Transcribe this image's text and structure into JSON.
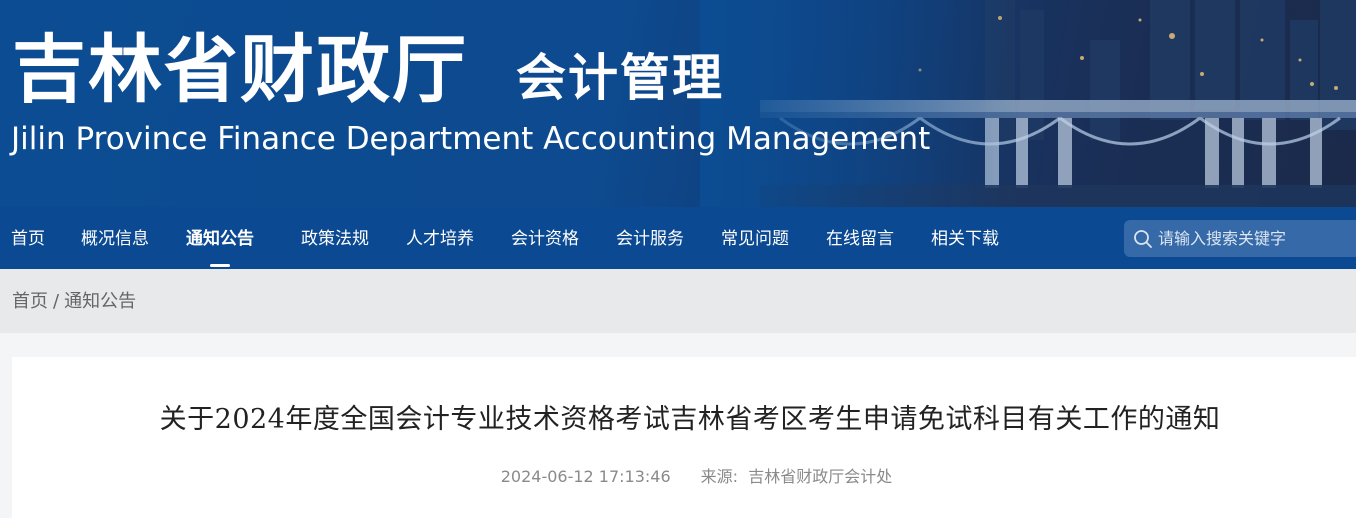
{
  "header": {
    "title": "吉林省财政厅",
    "subtitle": "会计管理",
    "english_title": "Jilin Province Finance Department Accounting Management"
  },
  "nav": {
    "items": [
      {
        "label": "首页"
      },
      {
        "label": "概况信息"
      },
      {
        "label": "通知公告"
      },
      {
        "label": "政策法规"
      },
      {
        "label": "人才培养"
      },
      {
        "label": "会计资格"
      },
      {
        "label": "会计服务"
      },
      {
        "label": "常见问题"
      },
      {
        "label": "在线留言"
      },
      {
        "label": "相关下载"
      }
    ],
    "active": "通知公告"
  },
  "search": {
    "placeholder": "请输入搜索关键字",
    "icon": "search-icon"
  },
  "breadcrumb": {
    "home": "首页",
    "separator": "/",
    "current": "通知公告"
  },
  "article": {
    "title": "关于2024年度全国会计专业技术资格考试吉林省考区考生申请免试科目有关工作的通知",
    "date": "2024-06-12 17:13:46",
    "source_label": "来源:",
    "source": "吉林省财政厅会计处"
  },
  "colors": {
    "nav_bg": "#0b4a92",
    "banner_bg": "#0c4c92",
    "crumb_bg": "#e8e9ea"
  }
}
